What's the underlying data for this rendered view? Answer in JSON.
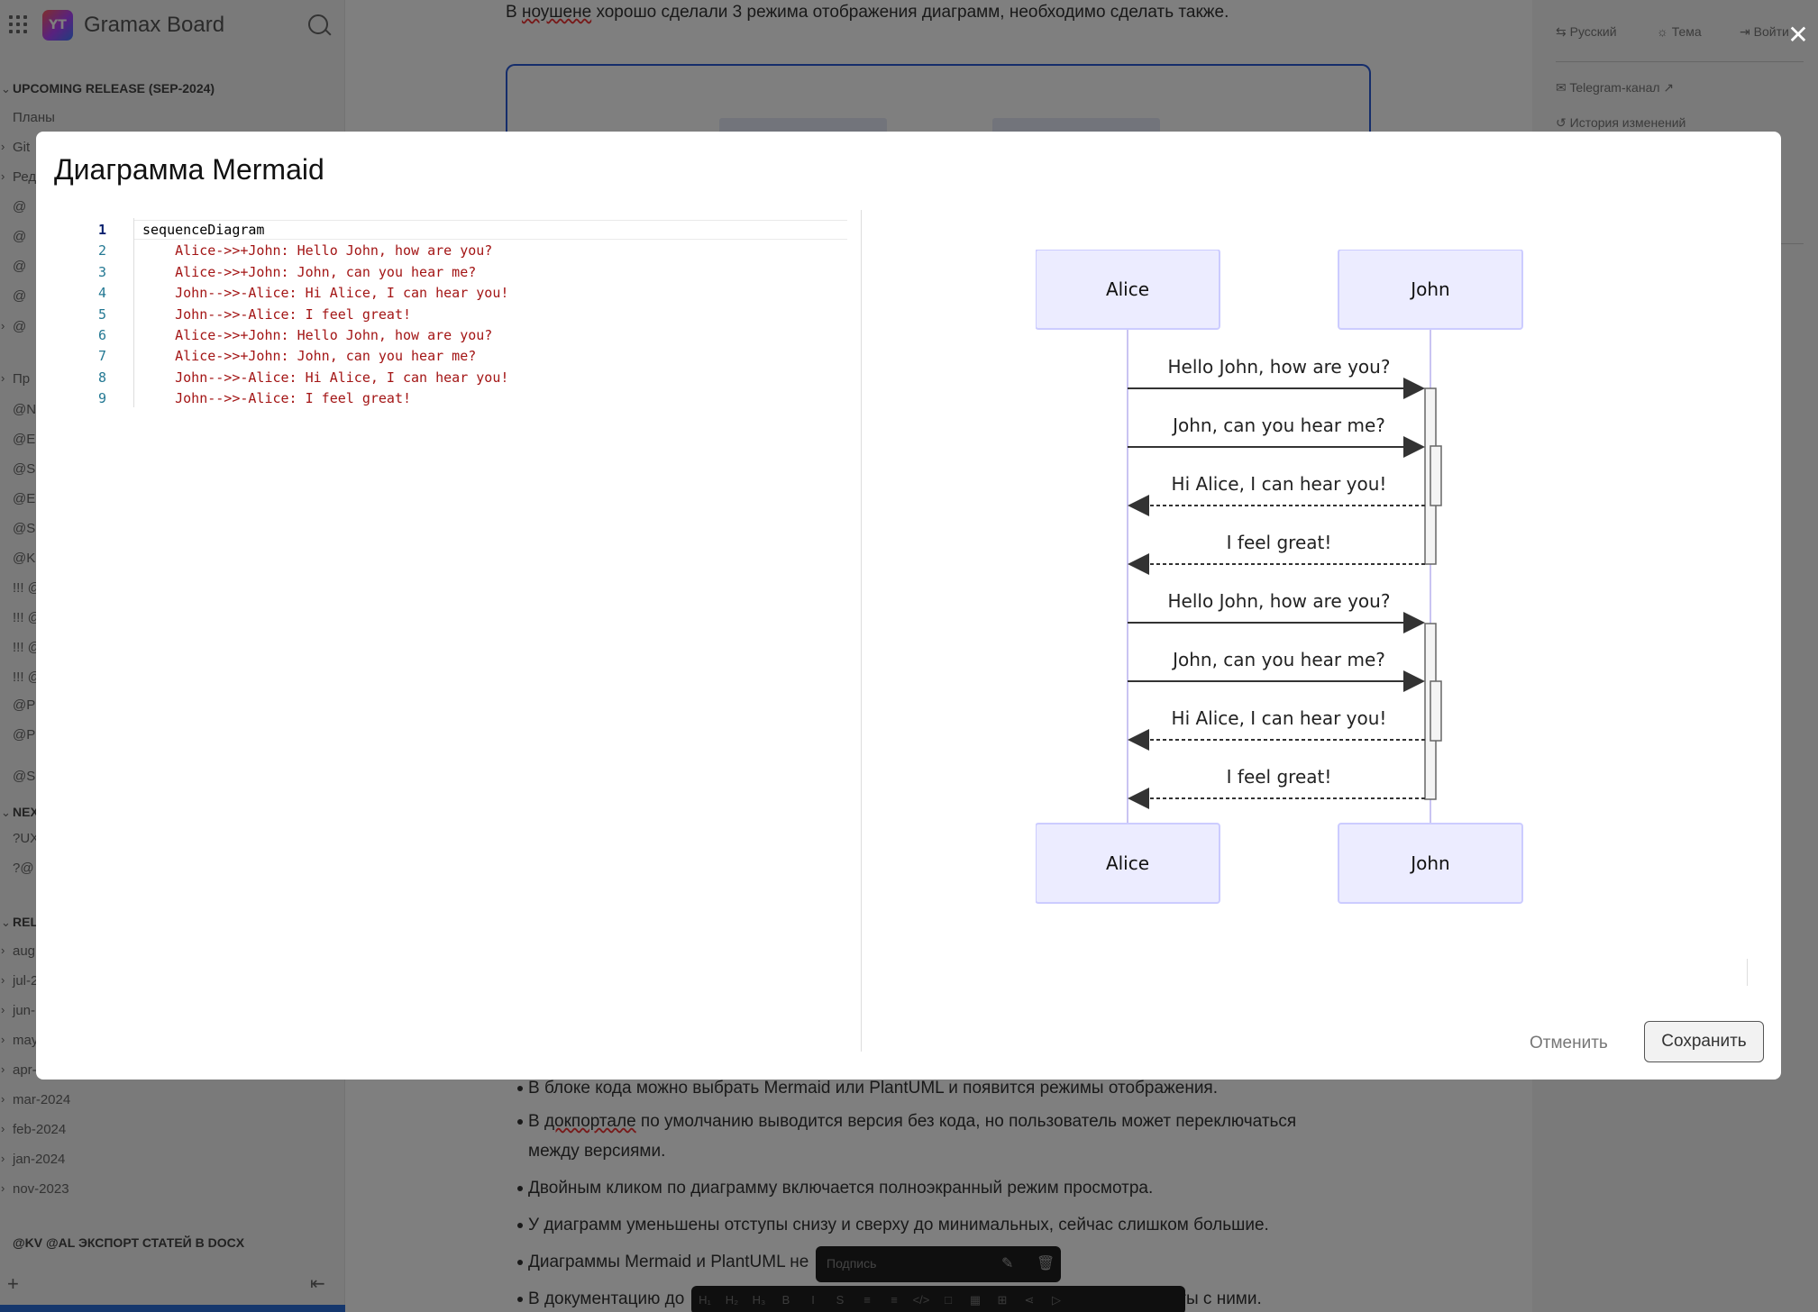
{
  "app": {
    "title": "Gramax Board",
    "logo_text": "YT"
  },
  "sidebar": {
    "sections": [
      {
        "label": "UPCOMING RELEASE (SEP-2024)"
      },
      {
        "label": "NEX"
      },
      {
        "label": "REL"
      }
    ],
    "items": [
      "Планы",
      "Git",
      "Ред",
      "@",
      "@",
      "@",
      "@",
      "@",
      "Пр",
      "@N",
      "@E",
      "@S",
      "@E",
      "@S",
      "@K",
      "!!! @",
      "!!! @",
      "!!! @",
      "!!! @",
      "@P",
      "@P",
      "@S",
      "?UX",
      "?@",
      "aug",
      "jul-2",
      "jun-",
      "may",
      "apr-",
      "mar-2024",
      "feb-2024",
      "jan-2024",
      "nov-2023"
    ],
    "footer_section": "@KV @AL ЭКСПОРТ СТАТЕЙ В DOCX"
  },
  "main": {
    "top_text_pre": "В ",
    "top_text_spell": "ноушене",
    "top_text_post": " хорошо сделали 3 режима отображения диаграмм, необходимо сделать также.",
    "bullets": [
      {
        "text": "В блоке кода можно выбрать Mermaid или PlantUML и появится режимы отображения."
      },
      {
        "pre": "В ",
        "spell": "докпортале",
        "post": " по умолчанию выводится версия без кода, но пользователь может переключаться"
      },
      {
        "text": "между версиями."
      },
      {
        "text": "Двойным кликом по диаграмму включается полноэкранный режим просмотра."
      },
      {
        "text": "У диаграмм уменьшены отступы снизу и сверху до минимальных, сейчас слишком большие."
      },
      {
        "text": "Диаграммы Mermaid и PlantUML не"
      },
      {
        "text": "В документацию до",
        "tail": "ты с ними."
      }
    ],
    "caption_placeholder": "Подпись",
    "format_buttons": [
      "H₁",
      "H₂",
      "H₃",
      "B",
      "I",
      "S",
      "≡",
      "≡",
      "</>",
      "□",
      "▦",
      "⊞",
      "⋖",
      "▷"
    ]
  },
  "rightpanel": {
    "lang": "Русский",
    "theme": "Тема",
    "login": "Войти",
    "telegram": "Telegram-канал",
    "history": "История изменений"
  },
  "modal": {
    "title": "Диаграмма Mermaid",
    "cancel_label": "Отменить",
    "save_label": "Сохранить",
    "close_icon": "close-icon",
    "code_lines": [
      "sequenceDiagram",
      "    Alice->>+John: Hello John, how are you?",
      "    Alice->>+John: John, can you hear me?",
      "    John-->>-Alice: Hi Alice, I can hear you!",
      "    John-->>-Alice: I feel great!",
      "    Alice->>+John: Hello John, how are you?",
      "    Alice->>+John: John, can you hear me?",
      "    John-->>-Alice: Hi Alice, I can hear you!",
      "    John-->>-Alice: I feel great!"
    ]
  },
  "diagram": {
    "participants": [
      "Alice",
      "John"
    ],
    "messages": [
      {
        "text": "Hello John, how are you?",
        "dir": "right",
        "style": "solid"
      },
      {
        "text": "John, can you hear me?",
        "dir": "right",
        "style": "solid"
      },
      {
        "text": "Hi Alice, I can hear you!",
        "dir": "left",
        "style": "dashed"
      },
      {
        "text": "I feel great!",
        "dir": "left",
        "style": "dashed"
      },
      {
        "text": "Hello John, how are you?",
        "dir": "right",
        "style": "solid"
      },
      {
        "text": "John, can you hear me?",
        "dir": "right",
        "style": "solid"
      },
      {
        "text": "Hi Alice, I can hear you!",
        "dir": "left",
        "style": "dashed"
      },
      {
        "text": "I feel great!",
        "dir": "left",
        "style": "dashed"
      }
    ],
    "colors": {
      "actor_fill": "#ECECFF",
      "actor_stroke": "#CCCCFF",
      "lifeline": "#c9c4f2",
      "arrow": "#333333"
    }
  }
}
